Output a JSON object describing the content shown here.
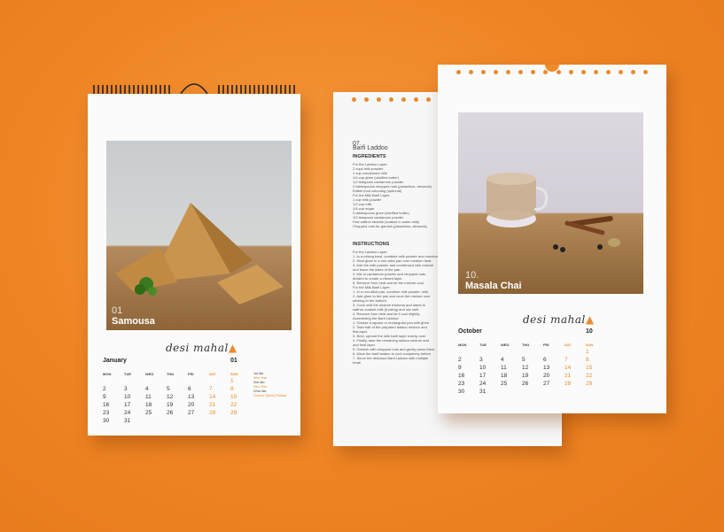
{
  "brand": {
    "logo_text": "desi mahal"
  },
  "january_page": {
    "photo_number": "01",
    "photo_title": "Samousa",
    "month": "January",
    "month_number": "01",
    "day_headers": [
      "MON",
      "TUE",
      "WED",
      "THU",
      "FRI",
      "SAT",
      "SUN"
    ],
    "rows": [
      [
        "",
        "",
        "",
        "",
        "",
        "",
        "1"
      ],
      [
        "2",
        "3",
        "4",
        "5",
        "6",
        "7",
        "8"
      ],
      [
        "9",
        "10",
        "11",
        "12",
        "13",
        "14",
        "15"
      ],
      [
        "16",
        "17",
        "18",
        "19",
        "20",
        "21",
        "22"
      ],
      [
        "23",
        "24",
        "25",
        "26",
        "27",
        "28",
        "29"
      ],
      [
        "30",
        "31",
        "",
        "",
        "",
        "",
        ""
      ]
    ],
    "notes": [
      "1st Jan",
      "New Year",
      "2nd Jan",
      "New Year",
      "22nd Jan",
      "Chinese Spring Festival"
    ]
  },
  "recipe_page": {
    "number": "07.",
    "name": "Barfi Laddoo",
    "ingredients_heading": "INGREDIENTS",
    "ingredients": [
      "For the Laddoo Layer:",
      "2 cups milk powder",
      "1 cup condensed milk",
      "1/4 cup ghee (clarified butter)",
      "1/2 teaspoon cardamom powder",
      "2 tablespoons chopped nuts (pistachios, almonds)",
      "Edible food colouring (optional)",
      "For the Milk Barfi Layer:",
      "1 cup milk powder",
      "1/2 cup milk",
      "1/4 cup sugar",
      "2 tablespoons ghee (clarified butter)",
      "1/2 teaspoon cardamom powder",
      "Few saffron strands (soaked in warm milk)",
      "Chopped nuts for garnish (pistachios, almonds)"
    ],
    "instructions_heading": "INSTRUCTIONS",
    "instructions": [
      "For the Laddoo Layer:",
      "1. In a mixing bowl, combine milk powder and condensed milk.",
      "2. Heat ghee in a non-stick pan over medium heat.",
      "3. Add the milk powder and condensed milk mixture",
      "and leave the sides of the pan.",
      "4. Mix in cardamom powder and chopped nuts.",
      "divided to create a vibrant layer.",
      "5. Remove from heat and let the mixture cool.",
      "For the Milk Barfi Layer:",
      "1. In a non-stick pan, combine milk powder, milk.",
      "2. Add ghee to the pan and cook the mixture over",
      "sticking to the bottom.",
      "3. Cook until the mixture thickens and starts to",
      "saffron-soaked milk (if using) and mix well.",
      "4. Remove from heat and let it cool slightly.",
      "Assembling the Barfi Laddoo:",
      "1. Grease a square or rectangular pan with ghee.",
      "2. Take half of the prepared laddoo mixture and",
      "first layer.",
      "3. Next, spread the milk barfi layer evenly over",
      "4. Finally, take the remaining laddoo mixture and",
      "and final layer.",
      "5. Garnish with chopped nuts and gently press them.",
      "6. Allow the barfi laddoo to cool completely before",
      "7. Serve the delicious Barfi Laddoo with multiple",
      "treat!"
    ]
  },
  "october_page": {
    "photo_number": "10.",
    "photo_title": "Masala Chai",
    "month": "October",
    "month_number": "10",
    "day_headers": [
      "MON",
      "TUE",
      "WED",
      "THU",
      "FRI",
      "SAT",
      "SUN"
    ],
    "rows": [
      [
        "",
        "",
        "",
        "",
        "",
        "",
        "1"
      ],
      [
        "2",
        "3",
        "4",
        "5",
        "6",
        "7",
        "8"
      ],
      [
        "9",
        "10",
        "11",
        "12",
        "13",
        "14",
        "15"
      ],
      [
        "16",
        "17",
        "18",
        "19",
        "20",
        "21",
        "22"
      ],
      [
        "23",
        "24",
        "25",
        "26",
        "27",
        "28",
        "29"
      ],
      [
        "30",
        "31",
        "",
        "",
        "",
        "",
        ""
      ]
    ]
  },
  "colors": {
    "background": "#f08a2a",
    "accent": "#f08a2a",
    "paper": "#fbfbfb"
  }
}
